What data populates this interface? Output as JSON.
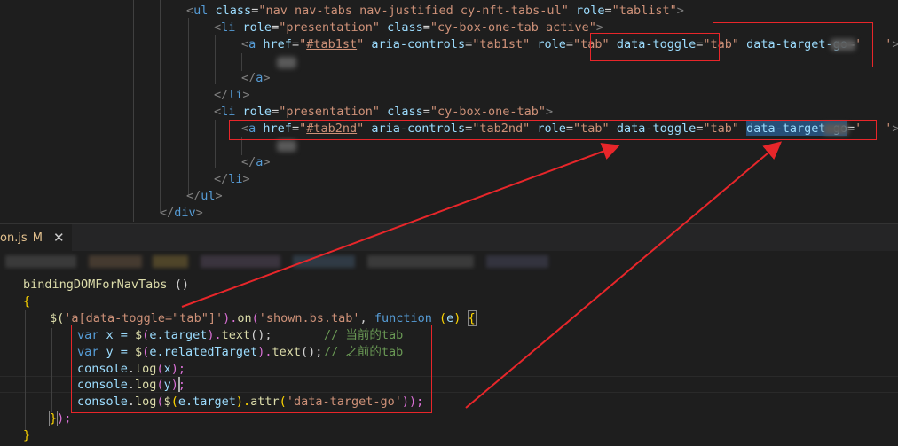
{
  "html_code": {
    "l1": {
      "open": "<",
      "tag": "ul",
      "a1": "class",
      "v1": "\"nav nav-tabs nav-justified cy-nft-tabs-ul\"",
      "a2": "role",
      "v2": "\"tablist\"",
      "close": ">"
    },
    "l2": {
      "open": "<",
      "tag": "li",
      "a1": "role",
      "v1": "\"presentation\"",
      "a2": "class",
      "v2": "\"cy-box-one-tab active\"",
      "close": ">"
    },
    "l3": {
      "open": "<",
      "tag": "a",
      "a1": "href",
      "v1a": "\"",
      "v1b": "#tab1st",
      "v1c": "\"",
      "a2": "aria-controls",
      "v2": "\"tab1st\"",
      "a3": "role",
      "v3": "\"tab\"",
      "a4": "data-toggle",
      "v4": "\"tab\"",
      "a5": "data-target-go",
      "eq": "=",
      "v5a": "'",
      "v5b": "'",
      "close": ">"
    },
    "l5": {
      "open": "</",
      "tag": "a",
      "close": ">"
    },
    "l6": {
      "open": "</",
      "tag": "li",
      "close": ">"
    },
    "l7": {
      "open": "<",
      "tag": "li",
      "a1": "role",
      "v1": "\"presentation\"",
      "a2": "class",
      "v2": "\"cy-box-one-tab\"",
      "close": ">"
    },
    "l8": {
      "open": "<",
      "tag": "a",
      "a1": "href",
      "v1a": "\"",
      "v1b": "#tab2nd",
      "v1c": "\"",
      "a2": "aria-controls",
      "v2": "\"tab2nd\"",
      "a3": "role",
      "v3": "\"tab\"",
      "a4": "data-toggle",
      "v4": "\"tab\"",
      "a5": "data-target-go",
      "eq": "=",
      "v5a": "'",
      "v5b": "'",
      "close": ">"
    },
    "l10": {
      "open": "</",
      "tag": "a",
      "close": ">"
    },
    "l11": {
      "open": "</",
      "tag": "li",
      "close": ">"
    },
    "l12": {
      "open": "</",
      "tag": "ul",
      "close": ">"
    },
    "l13": {
      "open": "</",
      "tag": "div",
      "close": ">"
    }
  },
  "editor_tab": {
    "filename": "on.js",
    "status": "M",
    "close": "✕"
  },
  "js_code": {
    "l1": {
      "fn": "bindingDOMForNavTabs",
      "paren": " ()"
    },
    "l2": {
      "brace": "{"
    },
    "l3": {
      "dollar": "$(",
      "s1": "'a[data-toggle=\"tab\"]'",
      "p1": ").",
      "on": "on",
      "p2": "(",
      "s2": "'shown.bs.tab'",
      "comma": ", ",
      "kwfn": "function",
      "sp": " ",
      "p3": "(",
      "e": "e",
      "p4": ")",
      "sp2": " ",
      "b": "{"
    },
    "l4": {
      "kw": "var",
      "v": " x = ",
      "d": "$",
      "p1": "(",
      "e": "e.target",
      "p2": ").",
      "m": "text",
      "p3": "();",
      "comment": "// 当前的tab"
    },
    "l5": {
      "kw": "var",
      "v": " y = ",
      "d": "$",
      "p1": "(",
      "e": "e.relatedTarget",
      "p2": ").",
      "m": "text",
      "p3": "();",
      "comment": "// 之前的tab"
    },
    "l6": {
      "c": "console",
      "dot": ".",
      "m": "log",
      "p1": "(",
      "a": "x",
      "p2": ");"
    },
    "l7": {
      "c": "console",
      "dot": ".",
      "m": "log",
      "p1": "(",
      "a": "y",
      "p2": ");"
    },
    "l8": {
      "c": "console",
      "dot": ".",
      "m": "log",
      "p1": "(",
      "d": "$",
      "p2": "(",
      "e": "e.target",
      "p3": ").",
      "m2": "attr",
      "p4": "(",
      "s": "'data-target-go'",
      "p5": "));"
    },
    "l9": {
      "b": "}",
      "p": ");"
    },
    "l10": {
      "brace": "}"
    }
  },
  "annotation_color": "#e8262a"
}
